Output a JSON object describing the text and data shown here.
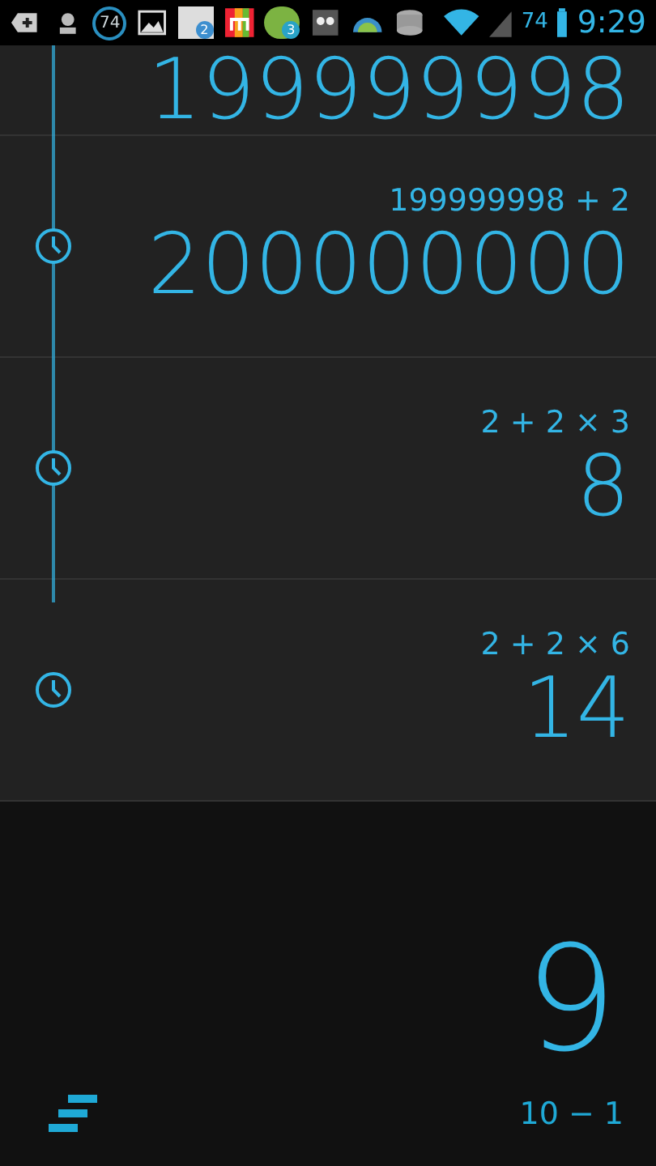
{
  "status_bar": {
    "notification_counts": [
      {
        "kind": "circle",
        "text": "74"
      },
      {
        "kind": "mail",
        "text": "2"
      },
      {
        "kind": "chat",
        "text": "3"
      }
    ],
    "battery_percent": "74",
    "time": "9:29"
  },
  "history": [
    {
      "result": "199999998"
    },
    {
      "expression": "199999998 + 2",
      "result": "200000000"
    },
    {
      "expression": "2 + 2 × 3",
      "result": "8"
    },
    {
      "expression": "2 + 2 × 6",
      "result": "14"
    }
  ],
  "display": {
    "result": "9",
    "expression": "10 − 1"
  }
}
